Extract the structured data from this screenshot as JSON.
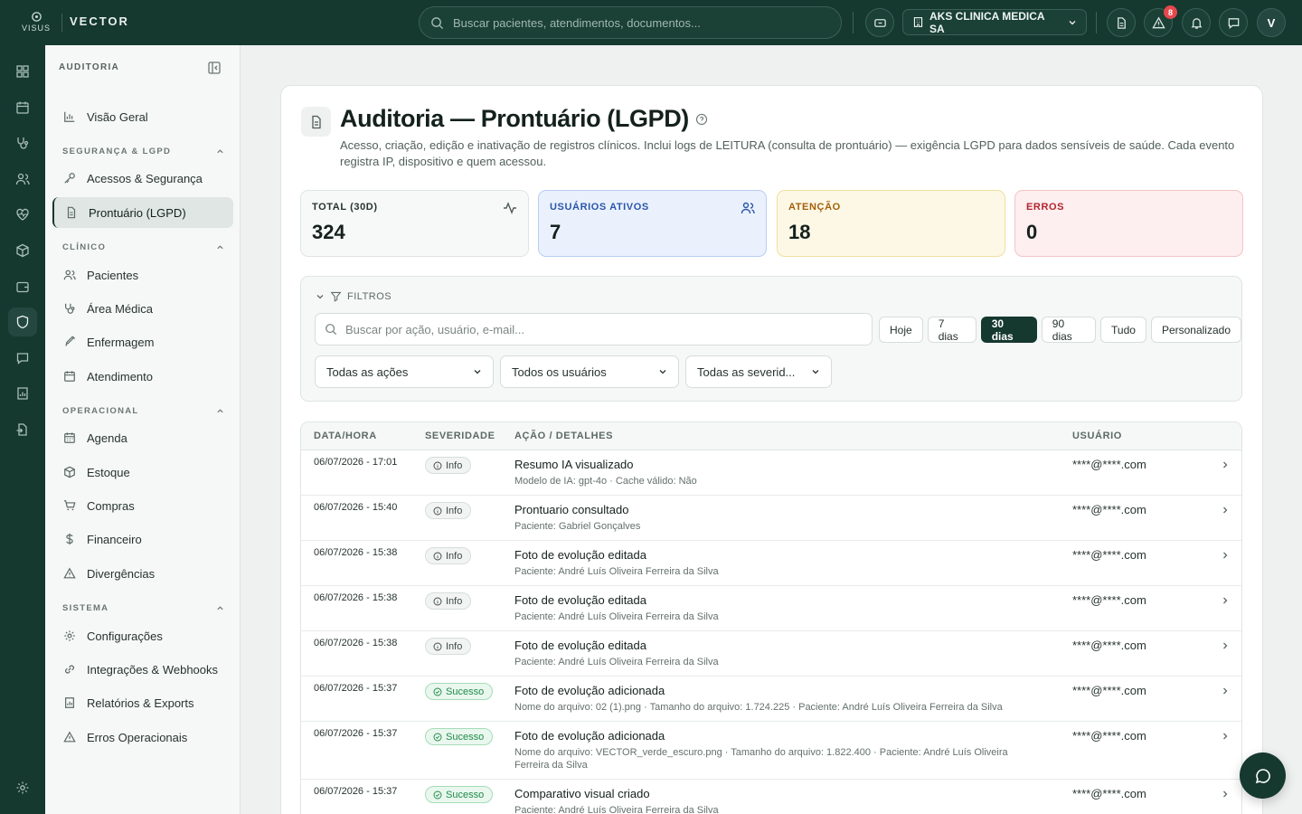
{
  "brand": {
    "logo_text": "VISUS",
    "name": "VECTOR"
  },
  "header": {
    "search_placeholder": "Buscar pacientes, atendimentos, documentos...",
    "clinic_name": "AKS CLINICA MEDICA SA",
    "alert_count": "8",
    "avatar_initial": "V"
  },
  "sidebar": {
    "title": "AUDITORIA",
    "overview": "Visão Geral",
    "sections": [
      {
        "title": "SEGURANÇA & LGPD",
        "items": [
          "Acessos & Segurança",
          "Prontuário (LGPD)"
        ]
      },
      {
        "title": "CLÍNICO",
        "items": [
          "Pacientes",
          "Área Médica",
          "Enfermagem",
          "Atendimento"
        ]
      },
      {
        "title": "OPERACIONAL",
        "items": [
          "Agenda",
          "Estoque",
          "Compras",
          "Financeiro",
          "Divergências"
        ]
      },
      {
        "title": "SISTEMA",
        "items": [
          "Configurações",
          "Integrações & Webhooks",
          "Relatórios & Exports",
          "Erros Operacionais"
        ]
      }
    ]
  },
  "page": {
    "title": "Auditoria — Prontuário (LGPD)",
    "description": "Acesso, criação, edição e inativação de registros clínicos. Inclui logs de LEITURA (consulta de prontuário) — exigência LGPD para dados sensíveis de saúde. Cada evento registra IP, dispositivo e quem acessou."
  },
  "stats": [
    {
      "label": "TOTAL (30D)",
      "value": "324",
      "color": "#26332f",
      "bg": "#f7f9f8",
      "border": "#dfe5e3"
    },
    {
      "label": "USUÁRIOS ATIVOS",
      "value": "7",
      "color": "#2b56a8",
      "bg": "#eaf1fd",
      "border": "#b9cdf2"
    },
    {
      "label": "ATENÇÃO",
      "value": "18",
      "color": "#a35f0a",
      "bg": "#fdf8e6",
      "border": "#f1df9d"
    },
    {
      "label": "ERROS",
      "value": "0",
      "color": "#b3242c",
      "bg": "#fdeeef",
      "border": "#f2c4c7"
    }
  ],
  "filters": {
    "title": "FILTROS",
    "search_placeholder": "Buscar por ação, usuário, e-mail...",
    "periods": [
      "Hoje",
      "7 dias",
      "30 dias",
      "90 dias",
      "Tudo",
      "Personalizado"
    ],
    "active_period": "30 dias",
    "dropdowns": [
      "Todas as ações",
      "Todos os usuários",
      "Todas as severid..."
    ]
  },
  "table": {
    "columns": [
      "DATA/HORA",
      "SEVERIDADE",
      "AÇÃO / DETALHES",
      "USUÁRIO"
    ],
    "rows": [
      {
        "datetime": "06/07/2026 - 17:01",
        "severity": "Info",
        "action": "Resumo IA visualizado",
        "details": "Modelo de IA: gpt-4o · Cache válido: Não",
        "user": "****@****.com"
      },
      {
        "datetime": "06/07/2026 - 15:40",
        "severity": "Info",
        "action": "Prontuario consultado",
        "details": "Paciente: Gabriel Gonçalves",
        "user": "****@****.com"
      },
      {
        "datetime": "06/07/2026 - 15:38",
        "severity": "Info",
        "action": "Foto de evolução editada",
        "details": "Paciente: André Luís Oliveira Ferreira da Silva",
        "user": "****@****.com"
      },
      {
        "datetime": "06/07/2026 - 15:38",
        "severity": "Info",
        "action": "Foto de evolução editada",
        "details": "Paciente: André Luís Oliveira Ferreira da Silva",
        "user": "****@****.com"
      },
      {
        "datetime": "06/07/2026 - 15:38",
        "severity": "Info",
        "action": "Foto de evolução editada",
        "details": "Paciente: André Luís Oliveira Ferreira da Silva",
        "user": "****@****.com"
      },
      {
        "datetime": "06/07/2026 - 15:37",
        "severity": "Sucesso",
        "action": "Foto de evolução adicionada",
        "details": "Nome do arquivo: 02 (1).png · Tamanho do arquivo: 1.724.225 · Paciente: André Luís Oliveira Ferreira da Silva",
        "user": "****@****.com"
      },
      {
        "datetime": "06/07/2026 - 15:37",
        "severity": "Sucesso",
        "action": "Foto de evolução adicionada",
        "details": "Nome do arquivo: VECTOR_verde_escuro.png · Tamanho do arquivo: 1.822.400 · Paciente: André Luís Oliveira Ferreira da Silva",
        "user": "****@****.com"
      },
      {
        "datetime": "06/07/2026 - 15:37",
        "severity": "Sucesso",
        "action": "Comparativo visual criado",
        "details": "Paciente: André Luís Oliveira Ferreira da Silva",
        "user": "****@****.com"
      }
    ]
  }
}
